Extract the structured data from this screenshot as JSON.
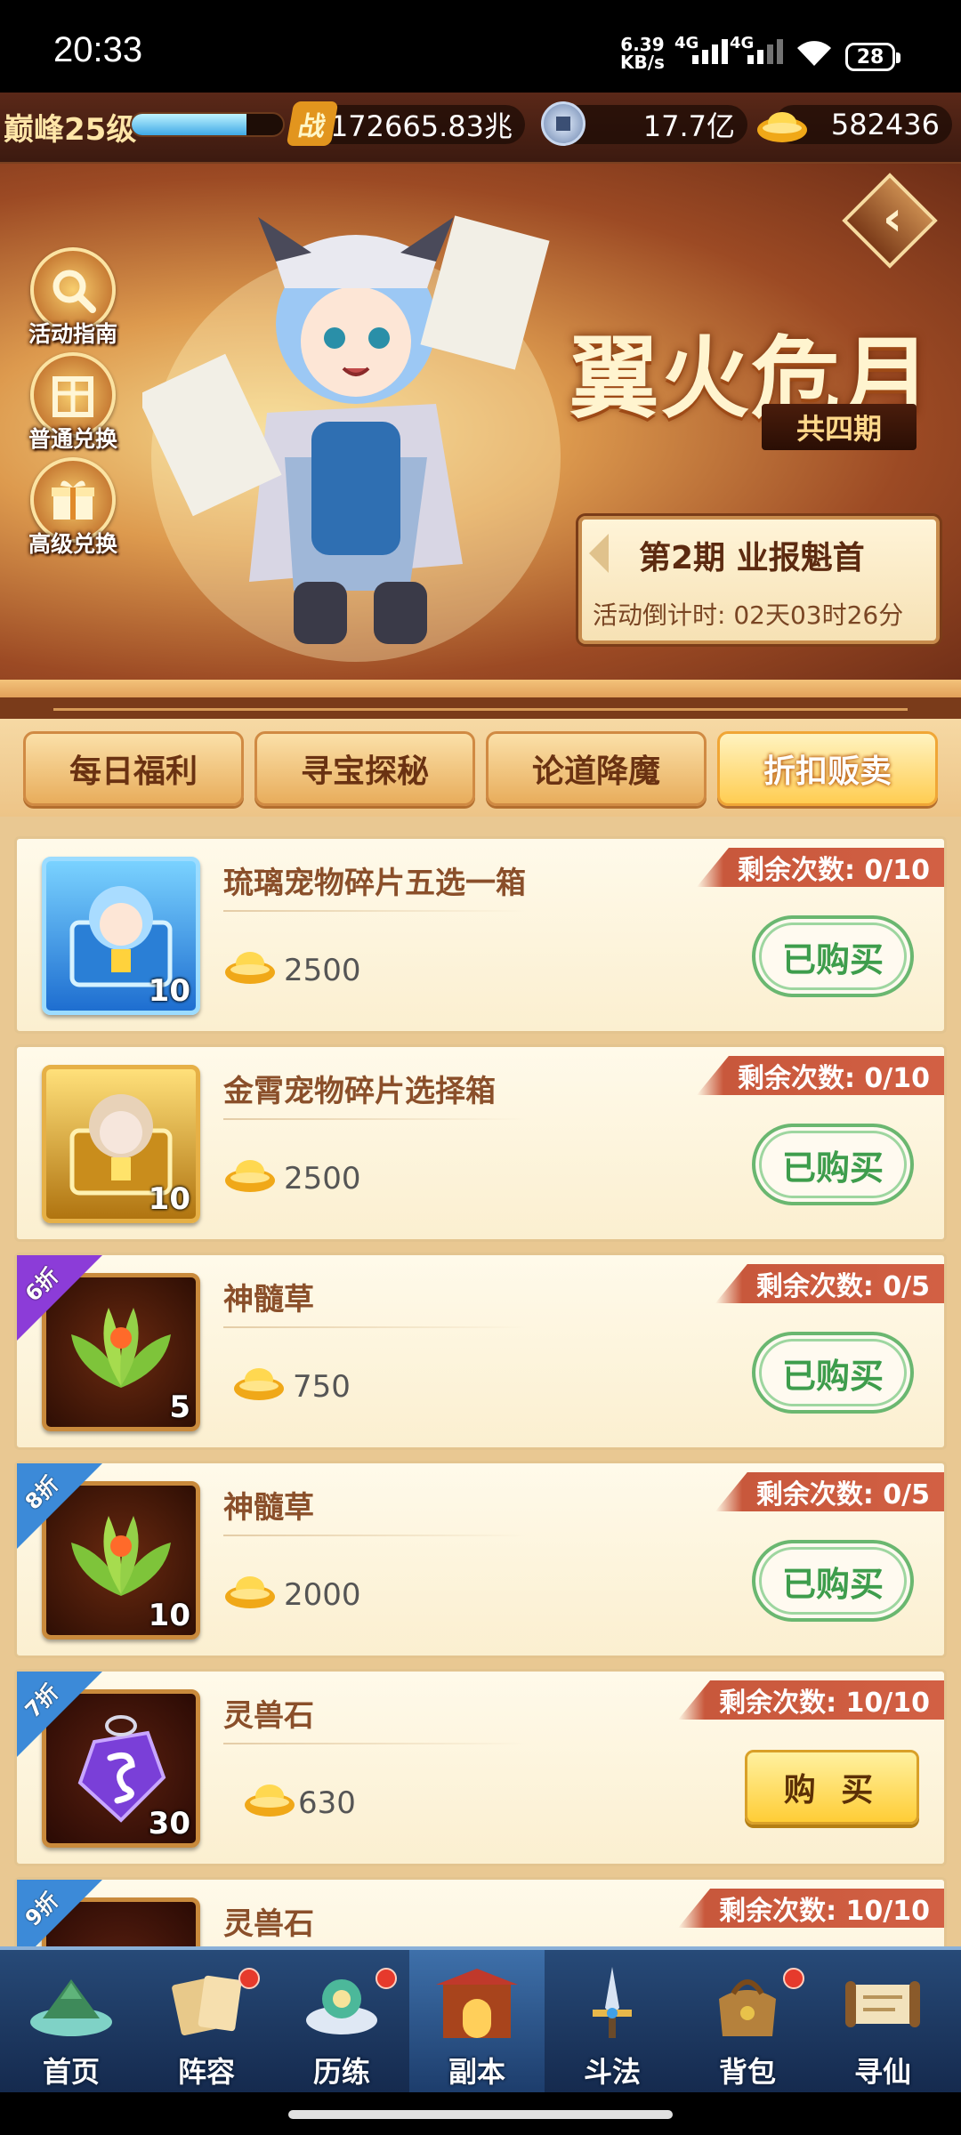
{
  "status_bar": {
    "time": "20:33",
    "net_speed_value": "6.39",
    "net_speed_unit": "KB/s",
    "sim1_label": "4G",
    "sim2_label": "4G",
    "battery": "28",
    "icons": [
      "signal-icon",
      "signal-icon",
      "wifi-icon",
      "battery-icon"
    ]
  },
  "resources": {
    "level": "巅峰25级",
    "xp_fraction": 0.76,
    "power_icon_char": "战",
    "power": "172665.83兆",
    "coins": "17.7亿",
    "gold": "582436"
  },
  "banner": {
    "title": "翼火危月",
    "total_periods": "共四期",
    "period_name": "第2期  业报魁首",
    "countdown": "活动倒计时: 02天03时26分",
    "side_buttons": [
      {
        "label": "活动指南",
        "icon": "magnifier-icon"
      },
      {
        "label": "普通兑换",
        "icon": "giftbox-icon"
      },
      {
        "label": "高级兑换",
        "icon": "gift-icon"
      }
    ]
  },
  "tabs": [
    {
      "label": "每日福利",
      "active": false
    },
    {
      "label": "寻宝探秘",
      "active": false
    },
    {
      "label": "论道降魔",
      "active": false
    },
    {
      "label": "折扣贩卖",
      "active": true
    }
  ],
  "shop": {
    "items": [
      {
        "name": "琉璃宠物碎片五选一箱",
        "qty": "10",
        "price": "2500",
        "remaining": "剩余次数: 0/10",
        "button": "已购买",
        "bought": true,
        "discount": "",
        "icon": "blue-chest-icon"
      },
      {
        "name": "金霄宠物碎片选择箱",
        "qty": "10",
        "price": "2500",
        "remaining": "剩余次数: 0/10",
        "button": "已购买",
        "bought": true,
        "discount": "",
        "icon": "gold-chest-icon"
      },
      {
        "name": "神髓草",
        "qty": "5",
        "price": "750",
        "remaining": "剩余次数: 0/5",
        "button": "已购买",
        "bought": true,
        "discount": "6折",
        "icon": "herb-icon"
      },
      {
        "name": "神髓草",
        "qty": "10",
        "price": "2000",
        "remaining": "剩余次数: 0/5",
        "button": "已购买",
        "bought": true,
        "discount": "8折",
        "icon": "herb-icon"
      },
      {
        "name": "灵兽石",
        "qty": "30",
        "price": "630",
        "remaining": "剩余次数: 10/10",
        "button": "购 买",
        "bought": false,
        "discount": "7折",
        "icon": "spirit-stone-icon"
      },
      {
        "name": "灵兽石",
        "qty": "",
        "price": "",
        "remaining": "剩余次数: 10/10",
        "button": "",
        "bought": false,
        "discount": "9折",
        "icon": "spirit-stone-icon"
      }
    ]
  },
  "bottom_nav": [
    {
      "label": "首页",
      "icon": "home-island-icon",
      "dot": false,
      "active": false
    },
    {
      "label": "阵容",
      "icon": "cards-icon",
      "dot": true,
      "active": false
    },
    {
      "label": "历练",
      "icon": "training-icon",
      "dot": true,
      "active": false
    },
    {
      "label": "副本",
      "icon": "gate-icon",
      "dot": false,
      "active": true
    },
    {
      "label": "斗法",
      "icon": "sword-icon",
      "dot": false,
      "active": false
    },
    {
      "label": "背包",
      "icon": "bag-icon",
      "dot": true,
      "active": false
    },
    {
      "label": "寻仙",
      "icon": "scroll-icon",
      "dot": false,
      "active": false
    }
  ],
  "colors": {
    "accent_gold": "#ffcd36",
    "bought_green": "#3e9d4c",
    "remain_red": "#c8583c",
    "discount_purple": "#8c3cd8",
    "discount_blue": "#3c8ad8"
  }
}
